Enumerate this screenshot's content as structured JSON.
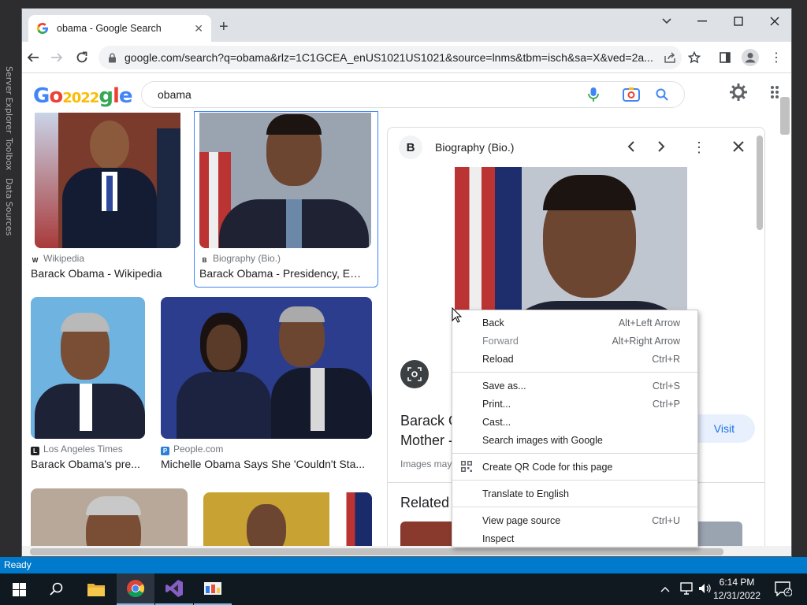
{
  "vs": {
    "left_panel_items": [
      "Server Explorer",
      "Toolbox",
      "Data Sources"
    ],
    "status": "Ready"
  },
  "browser": {
    "tab_title": "obama - Google Search",
    "url": "google.com/search?q=obama&rlz=1C1GCEA_enUS1021US1021&source=lnms&tbm=isch&sa=X&ved=2a..."
  },
  "google": {
    "query": "obama",
    "results": [
      {
        "source": "Wikipedia",
        "title": "Barack Obama - Wikipedia"
      },
      {
        "source": "Biography (Bio.)",
        "title": "Barack Obama - Presidency, Ed..."
      },
      {
        "source": "Los Angeles Times",
        "title": "Barack Obama's pre..."
      },
      {
        "source": "People.com",
        "title": "Michelle Obama Says She 'Couldn't Sta..."
      }
    ],
    "panel": {
      "source": "Biography (Bio.)",
      "badge": "B",
      "title_line1": "Barack O",
      "title_line2": "Mother -",
      "visit_label": "Visit",
      "notice": "Images may",
      "related": "Related"
    }
  },
  "context_menu": {
    "items": [
      {
        "label": "Back",
        "shortcut": "Alt+Left Arrow"
      },
      {
        "label": "Forward",
        "shortcut": "Alt+Right Arrow"
      },
      {
        "label": "Reload",
        "shortcut": "Ctrl+R"
      },
      {
        "label": "Save as...",
        "shortcut": "Ctrl+S"
      },
      {
        "label": "Print...",
        "shortcut": "Ctrl+P"
      },
      {
        "label": "Cast...",
        "shortcut": ""
      },
      {
        "label": "Search images with Google",
        "shortcut": ""
      },
      {
        "label": "Create QR Code for this page",
        "shortcut": ""
      },
      {
        "label": "Translate to English",
        "shortcut": ""
      },
      {
        "label": "View page source",
        "shortcut": "Ctrl+U"
      },
      {
        "label": "Inspect",
        "shortcut": ""
      }
    ]
  },
  "taskbar": {
    "time": "6:14 PM",
    "date": "12/31/2022",
    "notifications": "2"
  }
}
